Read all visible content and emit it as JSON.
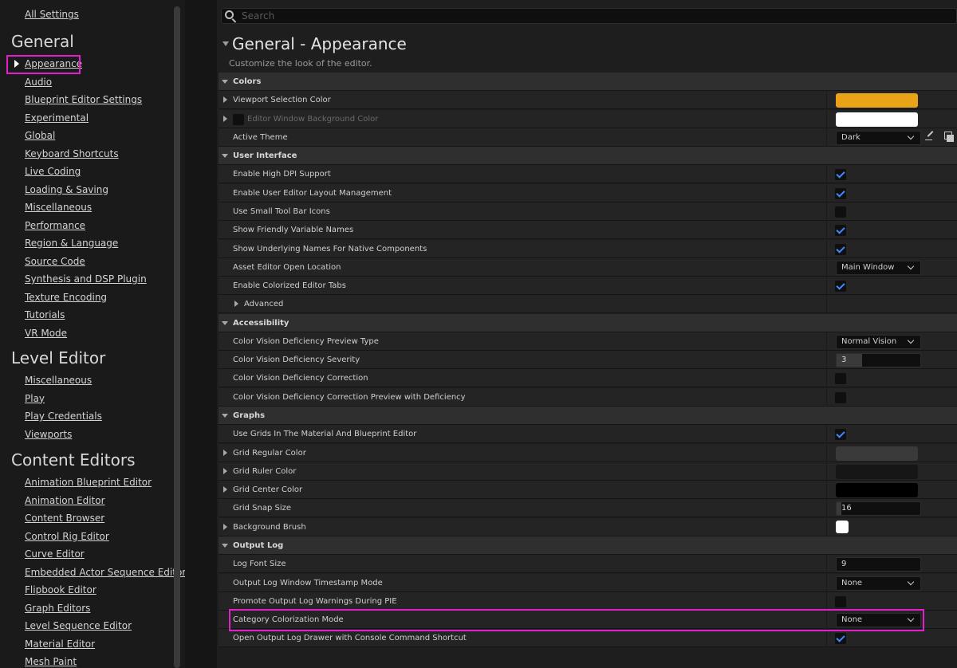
{
  "sidebar": {
    "all_settings": "All Settings",
    "sections": [
      {
        "heading": "General",
        "items": [
          "Appearance",
          "Audio",
          "Blueprint Editor Settings",
          "Experimental",
          "Global",
          "Keyboard Shortcuts",
          "Live Coding",
          "Loading & Saving",
          "Miscellaneous",
          "Performance",
          "Region & Language",
          "Source Code",
          "Synthesis and DSP Plugin",
          "Texture Encoding",
          "Tutorials",
          "VR Mode"
        ]
      },
      {
        "heading": "Level Editor",
        "items": [
          "Miscellaneous",
          "Play",
          "Play Credentials",
          "Viewports"
        ]
      },
      {
        "heading": "Content Editors",
        "items": [
          "Animation Blueprint Editor",
          "Animation Editor",
          "Content Browser",
          "Control Rig Editor",
          "Curve Editor",
          "Embedded Actor Sequence Editor",
          "Flipbook Editor",
          "Graph Editors",
          "Level Sequence Editor",
          "Material Editor",
          "Mesh Paint"
        ]
      }
    ],
    "selected": "Appearance"
  },
  "search": {
    "placeholder": "Search"
  },
  "page": {
    "title": "General - Appearance",
    "subtitle": "Customize the look of the editor."
  },
  "colors": {
    "accent": "#e020c8",
    "viewport_selection": "#e8a317",
    "checkbox_tick": "#3d8bff"
  },
  "rows": [
    {
      "type": "cat",
      "label": "Colors"
    },
    {
      "type": "prop",
      "label": "Viewport Selection Color",
      "expand": true,
      "control": "swatch",
      "color": "#e8a317"
    },
    {
      "type": "prop",
      "label": "Editor Window Background Color",
      "expand": true,
      "disabled": true,
      "control": "swatch",
      "color": "#ffffff"
    },
    {
      "type": "prop",
      "label": "Active Theme",
      "control": "combo",
      "value": "Dark",
      "extra": "theme-tools"
    },
    {
      "type": "cat",
      "label": "User Interface"
    },
    {
      "type": "prop",
      "label": "Enable High DPI Support",
      "control": "check",
      "value": true
    },
    {
      "type": "prop",
      "label": "Enable User Editor Layout Management",
      "control": "check",
      "value": true
    },
    {
      "type": "prop",
      "label": "Use Small Tool Bar Icons",
      "control": "check",
      "value": false
    },
    {
      "type": "prop",
      "label": "Show Friendly Variable Names",
      "control": "check",
      "value": true
    },
    {
      "type": "prop",
      "label": "Show Underlying Names For Native Components",
      "control": "check",
      "value": true
    },
    {
      "type": "prop",
      "label": "Asset Editor Open Location",
      "control": "combo",
      "value": "Main Window"
    },
    {
      "type": "prop",
      "label": "Enable Colorized Editor Tabs",
      "control": "check",
      "value": true
    },
    {
      "type": "prop",
      "label": "Advanced",
      "expand": true,
      "indent": true,
      "control": "none"
    },
    {
      "type": "cat",
      "label": "Accessibility"
    },
    {
      "type": "prop",
      "label": "Color Vision Deficiency Preview Type",
      "control": "combo",
      "value": "Normal Vision"
    },
    {
      "type": "prop",
      "label": "Color Vision Deficiency Severity",
      "control": "slider",
      "value": "3",
      "fraction": 0.3
    },
    {
      "type": "prop",
      "label": "Color Vision Deficiency Correction",
      "control": "check",
      "value": false
    },
    {
      "type": "prop",
      "label": "Color Vision Deficiency Correction Preview with Deficiency",
      "control": "check",
      "value": false
    },
    {
      "type": "cat",
      "label": "Graphs"
    },
    {
      "type": "prop",
      "label": "Use Grids In The Material And Blueprint Editor",
      "control": "check",
      "value": true
    },
    {
      "type": "prop",
      "label": "Grid Regular Color",
      "expand": true,
      "control": "swatch",
      "color": "#3a3a3a"
    },
    {
      "type": "prop",
      "label": "Grid Ruler Color",
      "expand": true,
      "control": "swatch",
      "color": "#161616"
    },
    {
      "type": "prop",
      "label": "Grid Center Color",
      "expand": true,
      "control": "swatch",
      "color": "#000000"
    },
    {
      "type": "prop",
      "label": "Grid Snap Size",
      "control": "slider",
      "value": "16",
      "fraction": 0.03
    },
    {
      "type": "prop",
      "label": "Background Brush",
      "expand": true,
      "control": "brush",
      "color": "#ffffff"
    },
    {
      "type": "cat",
      "label": "Output Log"
    },
    {
      "type": "prop",
      "label": "Log Font Size",
      "control": "number",
      "value": "9"
    },
    {
      "type": "prop",
      "label": "Output Log Window Timestamp Mode",
      "control": "combo",
      "value": "None"
    },
    {
      "type": "prop",
      "label": "Promote Output Log Warnings During PIE",
      "control": "check",
      "value": false
    },
    {
      "type": "prop",
      "label": "Category Colorization Mode",
      "control": "combo",
      "value": "None",
      "highlight": true
    },
    {
      "type": "prop",
      "label": "Open Output Log Drawer with Console Command Shortcut",
      "control": "check",
      "value": true
    }
  ]
}
